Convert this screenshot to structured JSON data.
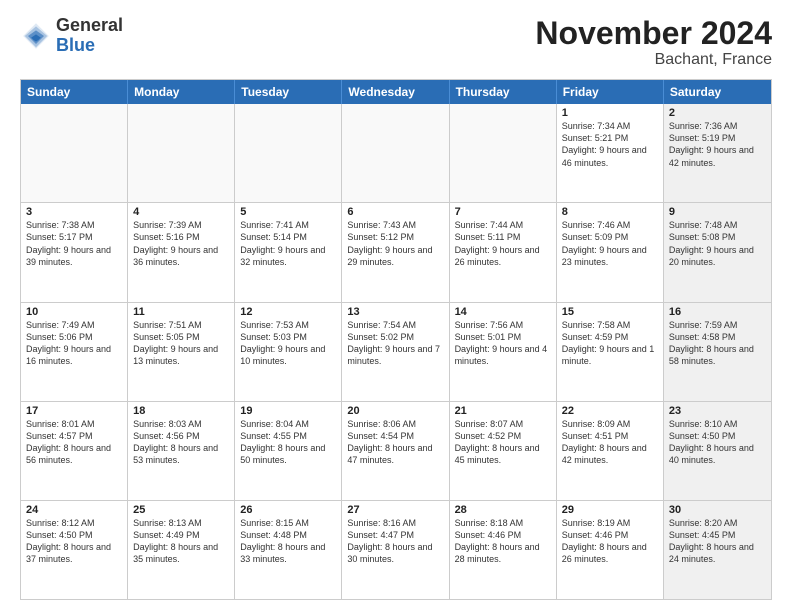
{
  "logo": {
    "general": "General",
    "blue": "Blue"
  },
  "title": "November 2024",
  "location": "Bachant, France",
  "days_header": [
    "Sunday",
    "Monday",
    "Tuesday",
    "Wednesday",
    "Thursday",
    "Friday",
    "Saturday"
  ],
  "rows": [
    [
      {
        "day": "",
        "info": "",
        "empty": true
      },
      {
        "day": "",
        "info": "",
        "empty": true
      },
      {
        "day": "",
        "info": "",
        "empty": true
      },
      {
        "day": "",
        "info": "",
        "empty": true
      },
      {
        "day": "",
        "info": "",
        "empty": true
      },
      {
        "day": "1",
        "info": "Sunrise: 7:34 AM\nSunset: 5:21 PM\nDaylight: 9 hours and 46 minutes.",
        "empty": false,
        "shaded": false
      },
      {
        "day": "2",
        "info": "Sunrise: 7:36 AM\nSunset: 5:19 PM\nDaylight: 9 hours and 42 minutes.",
        "empty": false,
        "shaded": true
      }
    ],
    [
      {
        "day": "3",
        "info": "Sunrise: 7:38 AM\nSunset: 5:17 PM\nDaylight: 9 hours and 39 minutes.",
        "empty": false,
        "shaded": false
      },
      {
        "day": "4",
        "info": "Sunrise: 7:39 AM\nSunset: 5:16 PM\nDaylight: 9 hours and 36 minutes.",
        "empty": false,
        "shaded": false
      },
      {
        "day": "5",
        "info": "Sunrise: 7:41 AM\nSunset: 5:14 PM\nDaylight: 9 hours and 32 minutes.",
        "empty": false,
        "shaded": false
      },
      {
        "day": "6",
        "info": "Sunrise: 7:43 AM\nSunset: 5:12 PM\nDaylight: 9 hours and 29 minutes.",
        "empty": false,
        "shaded": false
      },
      {
        "day": "7",
        "info": "Sunrise: 7:44 AM\nSunset: 5:11 PM\nDaylight: 9 hours and 26 minutes.",
        "empty": false,
        "shaded": false
      },
      {
        "day": "8",
        "info": "Sunrise: 7:46 AM\nSunset: 5:09 PM\nDaylight: 9 hours and 23 minutes.",
        "empty": false,
        "shaded": false
      },
      {
        "day": "9",
        "info": "Sunrise: 7:48 AM\nSunset: 5:08 PM\nDaylight: 9 hours and 20 minutes.",
        "empty": false,
        "shaded": true
      }
    ],
    [
      {
        "day": "10",
        "info": "Sunrise: 7:49 AM\nSunset: 5:06 PM\nDaylight: 9 hours and 16 minutes.",
        "empty": false,
        "shaded": false
      },
      {
        "day": "11",
        "info": "Sunrise: 7:51 AM\nSunset: 5:05 PM\nDaylight: 9 hours and 13 minutes.",
        "empty": false,
        "shaded": false
      },
      {
        "day": "12",
        "info": "Sunrise: 7:53 AM\nSunset: 5:03 PM\nDaylight: 9 hours and 10 minutes.",
        "empty": false,
        "shaded": false
      },
      {
        "day": "13",
        "info": "Sunrise: 7:54 AM\nSunset: 5:02 PM\nDaylight: 9 hours and 7 minutes.",
        "empty": false,
        "shaded": false
      },
      {
        "day": "14",
        "info": "Sunrise: 7:56 AM\nSunset: 5:01 PM\nDaylight: 9 hours and 4 minutes.",
        "empty": false,
        "shaded": false
      },
      {
        "day": "15",
        "info": "Sunrise: 7:58 AM\nSunset: 4:59 PM\nDaylight: 9 hours and 1 minute.",
        "empty": false,
        "shaded": false
      },
      {
        "day": "16",
        "info": "Sunrise: 7:59 AM\nSunset: 4:58 PM\nDaylight: 8 hours and 58 minutes.",
        "empty": false,
        "shaded": true
      }
    ],
    [
      {
        "day": "17",
        "info": "Sunrise: 8:01 AM\nSunset: 4:57 PM\nDaylight: 8 hours and 56 minutes.",
        "empty": false,
        "shaded": false
      },
      {
        "day": "18",
        "info": "Sunrise: 8:03 AM\nSunset: 4:56 PM\nDaylight: 8 hours and 53 minutes.",
        "empty": false,
        "shaded": false
      },
      {
        "day": "19",
        "info": "Sunrise: 8:04 AM\nSunset: 4:55 PM\nDaylight: 8 hours and 50 minutes.",
        "empty": false,
        "shaded": false
      },
      {
        "day": "20",
        "info": "Sunrise: 8:06 AM\nSunset: 4:54 PM\nDaylight: 8 hours and 47 minutes.",
        "empty": false,
        "shaded": false
      },
      {
        "day": "21",
        "info": "Sunrise: 8:07 AM\nSunset: 4:52 PM\nDaylight: 8 hours and 45 minutes.",
        "empty": false,
        "shaded": false
      },
      {
        "day": "22",
        "info": "Sunrise: 8:09 AM\nSunset: 4:51 PM\nDaylight: 8 hours and 42 minutes.",
        "empty": false,
        "shaded": false
      },
      {
        "day": "23",
        "info": "Sunrise: 8:10 AM\nSunset: 4:50 PM\nDaylight: 8 hours and 40 minutes.",
        "empty": false,
        "shaded": true
      }
    ],
    [
      {
        "day": "24",
        "info": "Sunrise: 8:12 AM\nSunset: 4:50 PM\nDaylight: 8 hours and 37 minutes.",
        "empty": false,
        "shaded": false
      },
      {
        "day": "25",
        "info": "Sunrise: 8:13 AM\nSunset: 4:49 PM\nDaylight: 8 hours and 35 minutes.",
        "empty": false,
        "shaded": false
      },
      {
        "day": "26",
        "info": "Sunrise: 8:15 AM\nSunset: 4:48 PM\nDaylight: 8 hours and 33 minutes.",
        "empty": false,
        "shaded": false
      },
      {
        "day": "27",
        "info": "Sunrise: 8:16 AM\nSunset: 4:47 PM\nDaylight: 8 hours and 30 minutes.",
        "empty": false,
        "shaded": false
      },
      {
        "day": "28",
        "info": "Sunrise: 8:18 AM\nSunset: 4:46 PM\nDaylight: 8 hours and 28 minutes.",
        "empty": false,
        "shaded": false
      },
      {
        "day": "29",
        "info": "Sunrise: 8:19 AM\nSunset: 4:46 PM\nDaylight: 8 hours and 26 minutes.",
        "empty": false,
        "shaded": false
      },
      {
        "day": "30",
        "info": "Sunrise: 8:20 AM\nSunset: 4:45 PM\nDaylight: 8 hours and 24 minutes.",
        "empty": false,
        "shaded": true
      }
    ]
  ]
}
